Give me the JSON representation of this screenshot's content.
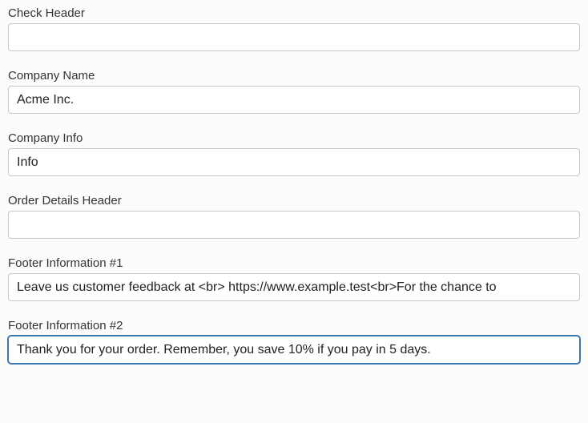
{
  "fields": {
    "check_header": {
      "label": "Check Header",
      "value": ""
    },
    "company_name": {
      "label": "Company Name",
      "value": "Acme Inc."
    },
    "company_info": {
      "label": "Company Info",
      "value": "Info"
    },
    "order_details_header": {
      "label": "Order Details Header",
      "value": ""
    },
    "footer_info_1": {
      "label": "Footer Information #1",
      "value": "Leave us customer feedback at <br> https://www.example.test<br>For the chance to"
    },
    "footer_info_2": {
      "label": "Footer Information #2",
      "value": "Thank you for your order. Remember, you save 10% if you pay in 5 days."
    }
  }
}
